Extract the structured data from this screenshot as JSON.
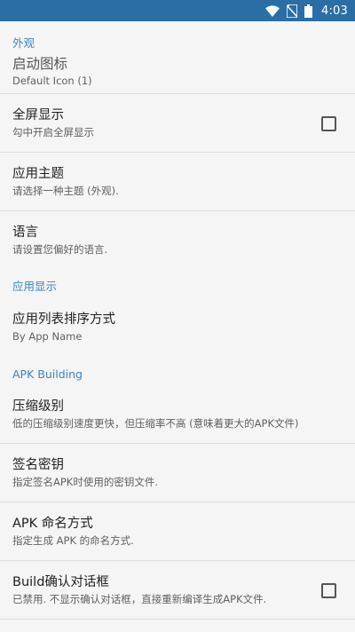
{
  "status_bar": {
    "time": "4:03",
    "icons": [
      "wifi-icon",
      "no-sim-icon",
      "battery-icon"
    ]
  },
  "sections": {
    "appearance": {
      "header": "外观",
      "launcher_icon": {
        "title": "启动图标",
        "summary": "Default Icon (1)"
      },
      "fullscreen": {
        "title": "全屏显示",
        "summary": "勾中开启全屏显示",
        "checked": false
      },
      "app_theme": {
        "title": "应用主题",
        "summary": "请选择一种主题 (外观)."
      },
      "language": {
        "title": "语言",
        "summary": "请设置您偏好的语言."
      }
    },
    "app_display": {
      "header": "应用显示",
      "sort_order": {
        "title": "应用列表排序方式",
        "summary": "By App Name"
      }
    },
    "apk_building": {
      "header": "APK Building",
      "compression": {
        "title": "压缩级别",
        "summary": "低的压缩级别速度更快，但压缩率不高 (意味着更大的APK文件)"
      },
      "signing_key": {
        "title": "签名密钥",
        "summary": "指定签名APK时使用的密钥文件."
      },
      "apk_naming": {
        "title": "APK 命名方式",
        "summary": "指定生成 APK 的命名方式."
      },
      "build_confirm": {
        "title": "Build确认对话框",
        "summary": "已禁用. 不显示确认对话框，直接重新编译生成APK文件.",
        "checked": false
      }
    }
  },
  "colors": {
    "status_bar": "#2b6ea6",
    "category_text": "#3c83bf",
    "background": "#f5f5f5"
  }
}
